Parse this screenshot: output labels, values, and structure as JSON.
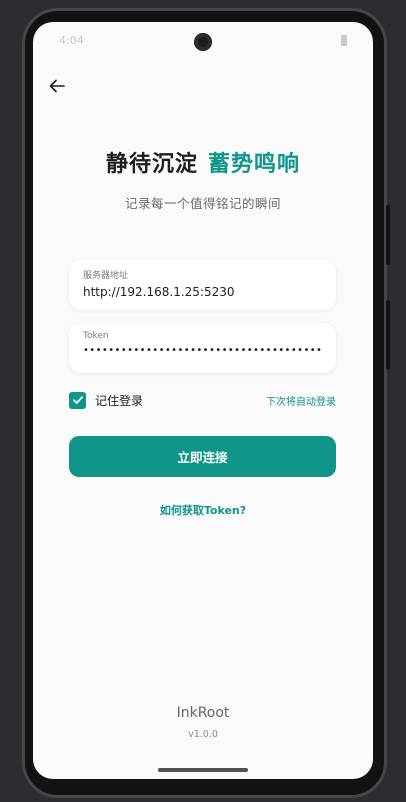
{
  "status_bar": {
    "time": "4:04"
  },
  "header": {
    "back_icon": "arrow-left-icon",
    "title_part1": "静待沉淀",
    "title_part2": "蓄势鸣响",
    "subtitle": "记录每一个值得铭记的瞬间"
  },
  "form": {
    "server": {
      "label": "服务器地址",
      "value": "http://192.168.1.25:5230"
    },
    "token": {
      "label": "Token",
      "value": "••••••••••••••••••••••••••••••••••••••••••••••••••••••"
    },
    "remember": {
      "label": "记住登录",
      "checked": true
    },
    "auto_login_text": "下次将自动登录",
    "connect_label": "立即连接",
    "help_link": "如何获取Token?"
  },
  "footer": {
    "app_name": "InkRoot",
    "version": "v1.0.0"
  },
  "colors": {
    "accent": "#0f9688",
    "text": "#1e1e1e",
    "background": "#fafafa"
  }
}
